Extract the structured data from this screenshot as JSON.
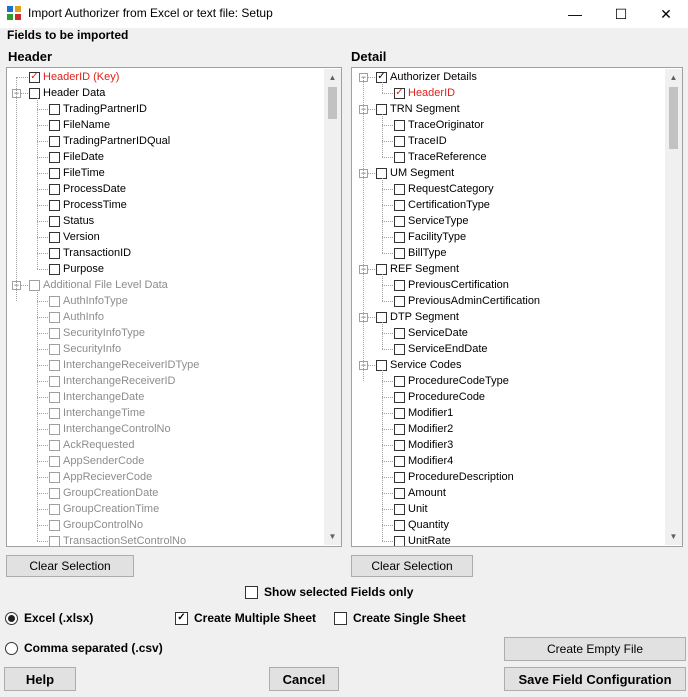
{
  "window": {
    "title": "Import Authorizer from Excel or text file: Setup",
    "minimize_glyph": "—",
    "maximize_glyph": "☐",
    "close_glyph": "✕"
  },
  "fields_label": "Fields to be imported",
  "header_panel": {
    "title": "Header",
    "items": [
      {
        "label": "HeaderID (Key)",
        "level": 0,
        "checked": true,
        "red": true,
        "disabled": false,
        "expander": ""
      },
      {
        "label": "Header Data",
        "level": 0,
        "checked": false,
        "red": false,
        "disabled": false,
        "expander": "-"
      },
      {
        "label": "TradingPartnerID",
        "level": 1,
        "checked": false,
        "disabled": false
      },
      {
        "label": "FileName",
        "level": 1,
        "checked": false,
        "disabled": false
      },
      {
        "label": "TradingPartnerIDQual",
        "level": 1,
        "checked": false,
        "disabled": false
      },
      {
        "label": "FileDate",
        "level": 1,
        "checked": false,
        "disabled": false
      },
      {
        "label": "FileTime",
        "level": 1,
        "checked": false,
        "disabled": false
      },
      {
        "label": "ProcessDate",
        "level": 1,
        "checked": false,
        "disabled": false
      },
      {
        "label": "ProcessTime",
        "level": 1,
        "checked": false,
        "disabled": false
      },
      {
        "label": "Status",
        "level": 1,
        "checked": false,
        "disabled": false
      },
      {
        "label": "Version",
        "level": 1,
        "checked": false,
        "disabled": false
      },
      {
        "label": "TransactionID",
        "level": 1,
        "checked": false,
        "disabled": false
      },
      {
        "label": "Purpose",
        "level": 1,
        "checked": false,
        "disabled": false
      },
      {
        "label": "Additional File Level Data",
        "level": 0,
        "checked": false,
        "disabled": true,
        "expander": "-"
      },
      {
        "label": "AuthInfoType",
        "level": 1,
        "checked": false,
        "disabled": true
      },
      {
        "label": "AuthInfo",
        "level": 1,
        "checked": false,
        "disabled": true
      },
      {
        "label": "SecurityInfoType",
        "level": 1,
        "checked": false,
        "disabled": true
      },
      {
        "label": "SecurityInfo",
        "level": 1,
        "checked": false,
        "disabled": true
      },
      {
        "label": "InterchangeReceiverIDType",
        "level": 1,
        "checked": false,
        "disabled": true
      },
      {
        "label": "InterchangeReceiverID",
        "level": 1,
        "checked": false,
        "disabled": true
      },
      {
        "label": "InterchangeDate",
        "level": 1,
        "checked": false,
        "disabled": true
      },
      {
        "label": "InterchangeTime",
        "level": 1,
        "checked": false,
        "disabled": true
      },
      {
        "label": "InterchangeControlNo",
        "level": 1,
        "checked": false,
        "disabled": true
      },
      {
        "label": "AckRequested",
        "level": 1,
        "checked": false,
        "disabled": true
      },
      {
        "label": "AppSenderCode",
        "level": 1,
        "checked": false,
        "disabled": true
      },
      {
        "label": "AppRecieverCode",
        "level": 1,
        "checked": false,
        "disabled": true
      },
      {
        "label": "GroupCreationDate",
        "level": 1,
        "checked": false,
        "disabled": true
      },
      {
        "label": "GroupCreationTime",
        "level": 1,
        "checked": false,
        "disabled": true
      },
      {
        "label": "GroupControlNo",
        "level": 1,
        "checked": false,
        "disabled": true
      },
      {
        "label": "TransactionSetControlNo",
        "level": 1,
        "checked": false,
        "disabled": true
      }
    ],
    "scroll_fraction": 0.0
  },
  "detail_panel": {
    "title": "Detail",
    "items": [
      {
        "label": "Authorizer Details",
        "level": 0,
        "checked": true,
        "red": false,
        "expander": "-"
      },
      {
        "label": "HeaderID",
        "level": 1,
        "checked": true,
        "red": true
      },
      {
        "label": "TRN Segment",
        "level": 0,
        "checked": false,
        "expander": "-"
      },
      {
        "label": "TraceOriginator",
        "level": 1,
        "checked": false
      },
      {
        "label": "TraceID",
        "level": 1,
        "checked": false
      },
      {
        "label": "TraceReference",
        "level": 1,
        "checked": false
      },
      {
        "label": "UM Segment",
        "level": 0,
        "checked": false,
        "expander": "-"
      },
      {
        "label": "RequestCategory",
        "level": 1,
        "checked": false
      },
      {
        "label": "CertificationType",
        "level": 1,
        "checked": false
      },
      {
        "label": "ServiceType",
        "level": 1,
        "checked": false
      },
      {
        "label": "FacilityType",
        "level": 1,
        "checked": false
      },
      {
        "label": "BillType",
        "level": 1,
        "checked": false
      },
      {
        "label": "REF Segment",
        "level": 0,
        "checked": false,
        "expander": "-"
      },
      {
        "label": "PreviousCertification",
        "level": 1,
        "checked": false
      },
      {
        "label": "PreviousAdminCertification",
        "level": 1,
        "checked": false
      },
      {
        "label": "DTP Segment",
        "level": 0,
        "checked": false,
        "expander": "-"
      },
      {
        "label": "ServiceDate",
        "level": 1,
        "checked": false
      },
      {
        "label": "ServiceEndDate",
        "level": 1,
        "checked": false
      },
      {
        "label": "Service Codes",
        "level": 0,
        "checked": false,
        "expander": "-"
      },
      {
        "label": "ProcedureCodeType",
        "level": 1,
        "checked": false
      },
      {
        "label": "ProcedureCode",
        "level": 1,
        "checked": false
      },
      {
        "label": "Modifier1",
        "level": 1,
        "checked": false
      },
      {
        "label": "Modifier2",
        "level": 1,
        "checked": false
      },
      {
        "label": "Modifier3",
        "level": 1,
        "checked": false
      },
      {
        "label": "Modifier4",
        "level": 1,
        "checked": false
      },
      {
        "label": "ProcedureDescription",
        "level": 1,
        "checked": false
      },
      {
        "label": "Amount",
        "level": 1,
        "checked": false
      },
      {
        "label": "Unit",
        "level": 1,
        "checked": false
      },
      {
        "label": "Quantity",
        "level": 1,
        "checked": false
      },
      {
        "label": "UnitRate",
        "level": 1,
        "checked": false
      }
    ],
    "scroll_fraction": 0.0
  },
  "clear_selection_label": "Clear Selection",
  "show_selected_label": "Show selected Fields only",
  "show_selected_checked": false,
  "format": {
    "excel_label": "Excel (.xlsx)",
    "csv_label": "Comma separated (.csv)",
    "selected": "excel"
  },
  "sheet": {
    "multiple_label": "Create Multiple Sheet",
    "multiple_checked": true,
    "single_label": "Create Single Sheet",
    "single_checked": false
  },
  "buttons": {
    "create_empty": "Create Empty File",
    "help": "Help",
    "cancel": "Cancel",
    "save_config": "Save Field Configuration"
  },
  "colors": {
    "required_field": "#e0221c",
    "disabled_text": "#8d8d8d"
  }
}
